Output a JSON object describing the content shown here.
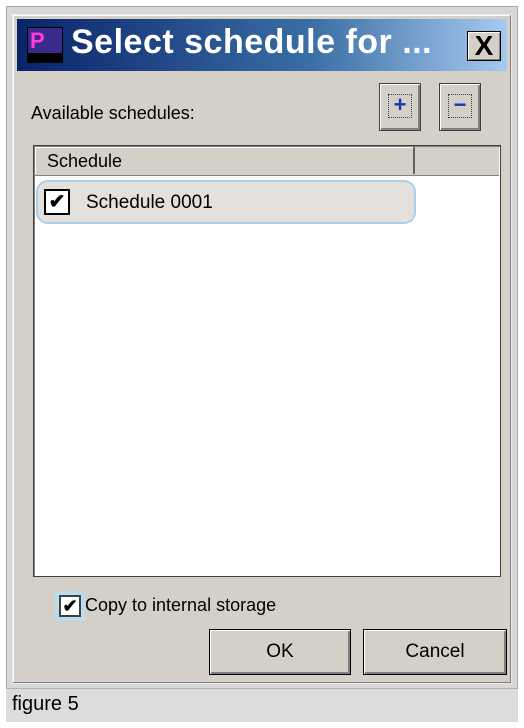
{
  "window": {
    "title": "Select schedule for ...",
    "close_glyph": "X",
    "icon": "app-icon"
  },
  "available_label": "Available schedules:",
  "toolbar": {
    "add_glyph": "+",
    "remove_glyph": "−"
  },
  "list": {
    "column_header": "Schedule",
    "rows": [
      {
        "label": "Schedule 0001",
        "checked": true,
        "check_glyph": "✔"
      }
    ]
  },
  "copy_option": {
    "label": "Copy to internal storage",
    "checked": true,
    "check_glyph": "✔"
  },
  "buttons": {
    "ok": "OK",
    "cancel": "Cancel"
  },
  "caption": "figure 5",
  "colors": {
    "title_start": "#0a246a",
    "title_end": "#a6caf0",
    "dialog_bg": "#d4d0c8",
    "highlight": "#a9d0ea"
  }
}
